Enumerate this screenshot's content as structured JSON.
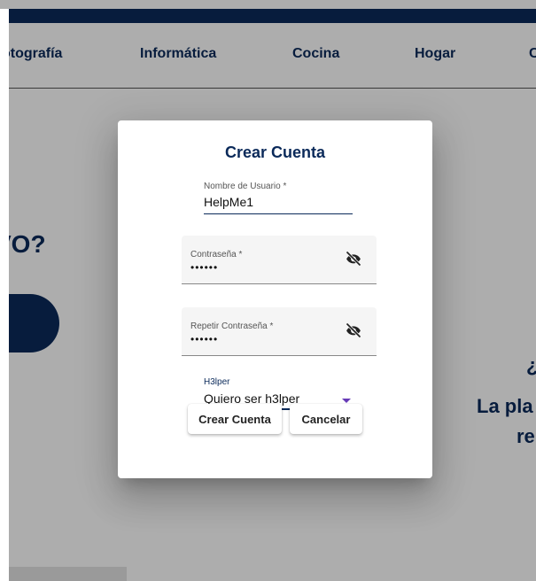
{
  "nav": {
    "items": [
      "otografía",
      "Informática",
      "Cocina",
      "Hogar",
      "C"
    ]
  },
  "hero": {
    "question": "VO?"
  },
  "right": {
    "line1": "¿",
    "line2": "La pla",
    "line3": "re"
  },
  "dialog": {
    "title": "Crear Cuenta",
    "username": {
      "label": "Nombre de Usuario *",
      "value": "HelpMe1"
    },
    "password": {
      "label": "Contraseña *",
      "value": "••••••"
    },
    "repeat_password": {
      "label": "Repetir Contraseña *",
      "value": "••••••"
    },
    "role": {
      "label": "H3lper",
      "value": "Quiero ser h3lper"
    },
    "buttons": {
      "create": "Crear Cuenta",
      "cancel": "Cancelar"
    }
  },
  "colors": {
    "brand_navy": "#0b2a5a",
    "accent_purple": "#673ab7"
  },
  "icons": {
    "password_toggle": "eye-off-icon",
    "select_arrow": "dropdown-arrow-icon"
  }
}
